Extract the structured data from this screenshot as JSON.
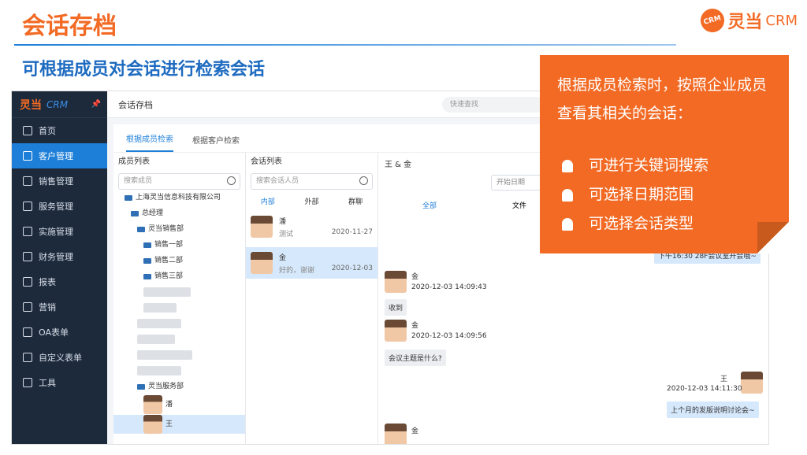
{
  "slide": {
    "title": "会话存档",
    "subtitle": "可根据成员对会话进行检索会话",
    "logo_text": "灵当",
    "logo_crm": "CRM",
    "logo_badge": "CRM"
  },
  "app": {
    "sidebar": {
      "logo_main": "灵当",
      "logo_sub": "CRM",
      "items": [
        {
          "label": "首页",
          "icon": "home-icon"
        },
        {
          "label": "客户管理",
          "icon": "user-icon",
          "active": true
        },
        {
          "label": "销售管理",
          "icon": "document-icon"
        },
        {
          "label": "服务管理",
          "icon": "service-icon"
        },
        {
          "label": "实施管理",
          "icon": "implement-icon"
        },
        {
          "label": "财务管理",
          "icon": "finance-icon"
        },
        {
          "label": "报表",
          "icon": "report-icon"
        },
        {
          "label": "营销",
          "icon": "marketing-icon"
        },
        {
          "label": "OA表单",
          "icon": "form-icon"
        },
        {
          "label": "自定义表单",
          "icon": "custom-form-icon"
        },
        {
          "label": "工具",
          "icon": "tools-icon"
        }
      ]
    },
    "topbar": {
      "title": "会话存档",
      "search_placeholder": "快速查找"
    },
    "tabs": [
      "根据成员检索",
      "根据客户检索"
    ],
    "member_list": {
      "header": "成员列表",
      "search_placeholder": "搜索成员",
      "company": "上海灵当信息科技有限公司",
      "gm": "总经理",
      "sales_dept": "灵当销售部",
      "sales_units": [
        "销售一部",
        "销售二部",
        "销售三部"
      ],
      "service_dept": "灵当服务部",
      "members": [
        "潘",
        "王"
      ]
    },
    "conv_list": {
      "header": "会话列表",
      "search_placeholder": "搜索会话人员",
      "filters": [
        "内部",
        "外部",
        "群聊"
      ],
      "items": [
        {
          "name": "潘",
          "snippet": "测试",
          "date": "2020-11-27"
        },
        {
          "name": "金",
          "snippet": "好的，谢谢",
          "date": "2020-12-03"
        }
      ]
    },
    "chat": {
      "header": "王 & 金",
      "date_placeholder": "开始日期",
      "tabs": [
        "全部",
        "文件"
      ],
      "messages": [
        {
          "text": "下午16:30 28F会议室开会哦~"
        },
        {
          "sender": "金",
          "time": "2020-12-03 14:09:43",
          "text": "收到"
        },
        {
          "sender": "金",
          "time": "2020-12-03 14:09:56",
          "text": "会议主题是什么?"
        },
        {
          "sender": "王",
          "time": "2020-12-03 14:11:30",
          "text": "上个月的发版说明讨论会~"
        },
        {
          "sender": "金"
        }
      ]
    }
  },
  "callout": {
    "intro": "根据成员检索时，按照企业成员查看其相关的会话：",
    "points": [
      "可进行关键词搜索",
      "可选择日期范围",
      "可选择会话类型"
    ],
    "bg_color": "#f26a24"
  }
}
